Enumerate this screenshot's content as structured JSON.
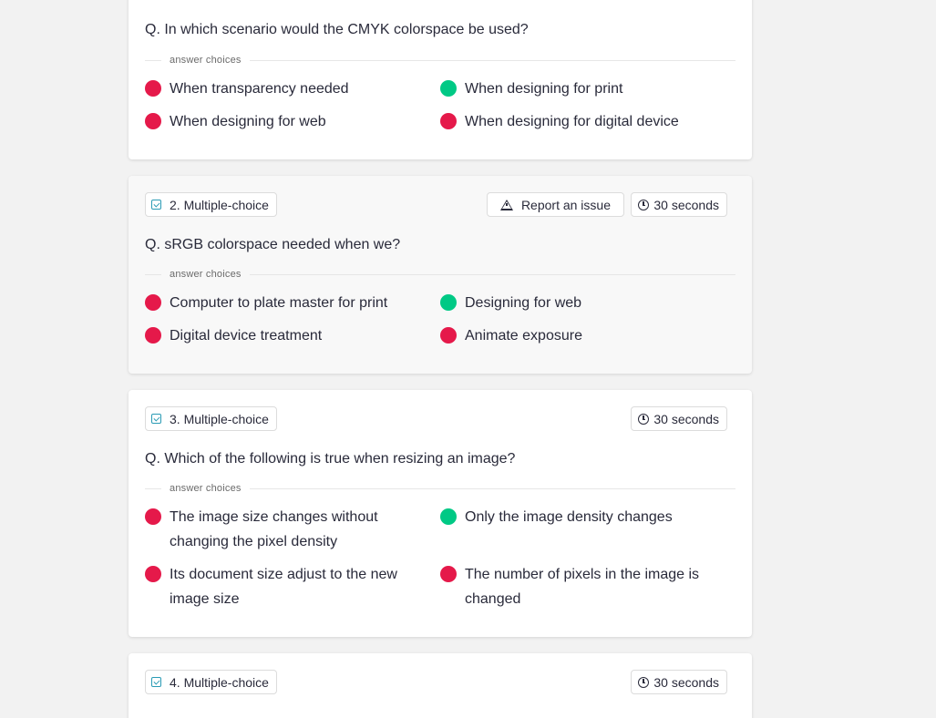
{
  "colors": {
    "correct": "#00c985",
    "incorrect": "#e5194a",
    "accent": "#2a9bb5"
  },
  "answer_choices_label": "answer choices",
  "questions": [
    {
      "question": "Q. In which scenario would the CMYK colorspace be used?",
      "options": [
        {
          "text": "When transparency needed",
          "correct": false
        },
        {
          "text": "When designing for print",
          "correct": true
        },
        {
          "text": "When designing for web",
          "correct": false
        },
        {
          "text": "When designing for digital device",
          "correct": false
        }
      ]
    },
    {
      "type_label": "2. Multiple-choice",
      "report_label": "Report an issue",
      "time_label": "30 seconds",
      "question": "Q. sRGB colorspace needed when we?",
      "options": [
        {
          "text": "Computer to plate master for print",
          "correct": false
        },
        {
          "text": "Designing for web",
          "correct": true
        },
        {
          "text": "Digital device treatment",
          "correct": false
        },
        {
          "text": "Animate exposure",
          "correct": false
        }
      ]
    },
    {
      "type_label": "3. Multiple-choice",
      "time_label": "30 seconds",
      "question": "Q. Which of the following is true when resizing an image?",
      "options": [
        {
          "text": "The image size changes without changing the pixel density",
          "correct": false
        },
        {
          "text": "Only the image density changes",
          "correct": true
        },
        {
          "text": "Its document size adjust to the new image size",
          "correct": false
        },
        {
          "text": "The number of pixels in the image is changed",
          "correct": false
        }
      ]
    },
    {
      "type_label": "4. Multiple-choice",
      "time_label": "30 seconds"
    }
  ]
}
